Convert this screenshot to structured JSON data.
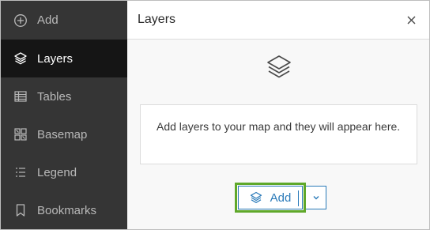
{
  "sidebar": {
    "items": [
      {
        "label": "Add",
        "icon": "plus-circle-icon"
      },
      {
        "label": "Layers",
        "icon": "layers-icon",
        "active": true
      },
      {
        "label": "Tables",
        "icon": "table-icon"
      },
      {
        "label": "Basemap",
        "icon": "basemap-icon"
      },
      {
        "label": "Legend",
        "icon": "legend-icon"
      },
      {
        "label": "Bookmarks",
        "icon": "bookmark-icon"
      }
    ]
  },
  "panel": {
    "title": "Layers",
    "empty_message": "Add layers to your map and they will appear here.",
    "add_label": "Add"
  },
  "colors": {
    "sidebar_bg": "#353535",
    "sidebar_active_bg": "#151515",
    "accent": "#2b7bb9",
    "highlight": "#5fa82a"
  }
}
